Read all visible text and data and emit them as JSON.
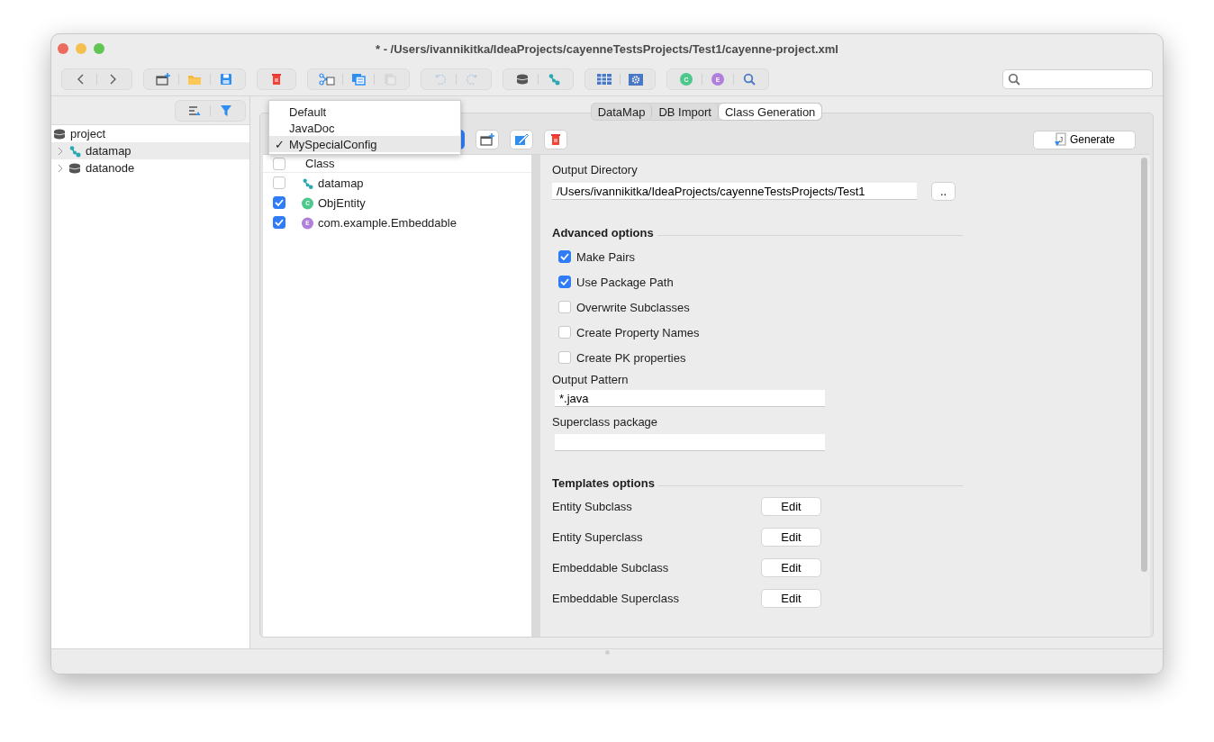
{
  "window": {
    "title": "* - /Users/ivannikitka/IdeaProjects/cayenneTestsProjects/Test1/cayenne-project.xml"
  },
  "toolbar": {
    "groups": [
      [
        {
          "kind": "back",
          "disabled": false
        },
        {
          "kind": "forward",
          "disabled": false
        }
      ],
      [
        {
          "kind": "new-project",
          "disabled": false
        },
        {
          "kind": "open",
          "disabled": false
        },
        {
          "kind": "save",
          "disabled": false
        }
      ],
      [
        {
          "kind": "remove",
          "disabled": false
        }
      ],
      [
        {
          "kind": "cut",
          "disabled": false
        },
        {
          "kind": "copy",
          "disabled": false
        },
        {
          "kind": "paste",
          "disabled": true
        }
      ],
      [
        {
          "kind": "undo",
          "disabled": true
        },
        {
          "kind": "redo",
          "disabled": true
        }
      ],
      [
        {
          "kind": "datanode",
          "disabled": false
        },
        {
          "kind": "datamap",
          "disabled": false
        }
      ],
      [
        {
          "kind": "table",
          "disabled": false
        },
        {
          "kind": "gear",
          "disabled": false
        }
      ],
      [
        {
          "kind": "badge",
          "letter": "C",
          "color": "#4cc98a",
          "disabled": false
        },
        {
          "kind": "badge",
          "letter": "E",
          "color": "#b07fdc",
          "disabled": false
        },
        {
          "kind": "search",
          "disabled": false
        }
      ]
    ]
  },
  "sidebar": {
    "tools": [
      {
        "kind": "sort"
      },
      {
        "kind": "filter"
      }
    ],
    "tree": [
      {
        "label": "project",
        "kind": "datanode",
        "selected": false,
        "children": [
          {
            "label": "datamap",
            "kind": "datamap",
            "selected": true,
            "expanded": false
          },
          {
            "label": "datanode",
            "kind": "datanode",
            "selected": false,
            "expanded": false
          }
        ]
      }
    ]
  },
  "tabs": [
    {
      "label": "DataMap",
      "selected": false
    },
    {
      "label": "DB Import",
      "selected": false
    },
    {
      "label": "Class Generation",
      "selected": true
    }
  ],
  "config_toolbar": {
    "buttons": [
      {
        "kind": "add"
      },
      {
        "kind": "edit"
      },
      {
        "kind": "remove"
      }
    ],
    "generate": {
      "label": "Generate",
      "icon_letter": "J"
    }
  },
  "config_menu": {
    "check_mark": "✓",
    "items": [
      {
        "label": "Default",
        "selected": false
      },
      {
        "label": "JavaDoc",
        "selected": false
      },
      {
        "label": "MySpecialConfig",
        "selected": true
      }
    ]
  },
  "class_table": {
    "header": {
      "label": "Class",
      "checked": false
    },
    "rows": [
      {
        "label": "datamap",
        "kind": "datamap",
        "checked": false
      },
      {
        "label": "ObjEntity",
        "kind": "badge",
        "letter": "C",
        "color": "#4cc98a",
        "checked": true
      },
      {
        "label": "com.example.Embeddable",
        "kind": "badge",
        "letter": "E",
        "color": "#b07fdc",
        "checked": true
      }
    ]
  },
  "form": {
    "output_directory": {
      "label": "Output Directory",
      "value": "/Users/ivannikitka/IdeaProjects/cayenneTestsProjects/Test1",
      "browse": ".."
    },
    "advanced": {
      "title": "Advanced options",
      "options": [
        {
          "label": "Make Pairs",
          "checked": true
        },
        {
          "label": "Use Package Path",
          "checked": true
        },
        {
          "label": "Overwrite Subclasses",
          "checked": false
        },
        {
          "label": "Create Property Names",
          "checked": false
        },
        {
          "label": "Create PK properties",
          "checked": false
        }
      ]
    },
    "output_pattern": {
      "label": "Output Pattern",
      "value": "*.java"
    },
    "superclass_package": {
      "label": "Superclass package"
    },
    "templates": {
      "title": "Templates options",
      "rows": [
        {
          "label": "Entity Subclass",
          "button": "Edit"
        },
        {
          "label": "Entity Superclass",
          "button": "Edit"
        },
        {
          "label": "Embeddable Subclass",
          "button": "Edit"
        },
        {
          "label": "Embeddable Superclass",
          "button": "Edit"
        }
      ]
    }
  }
}
